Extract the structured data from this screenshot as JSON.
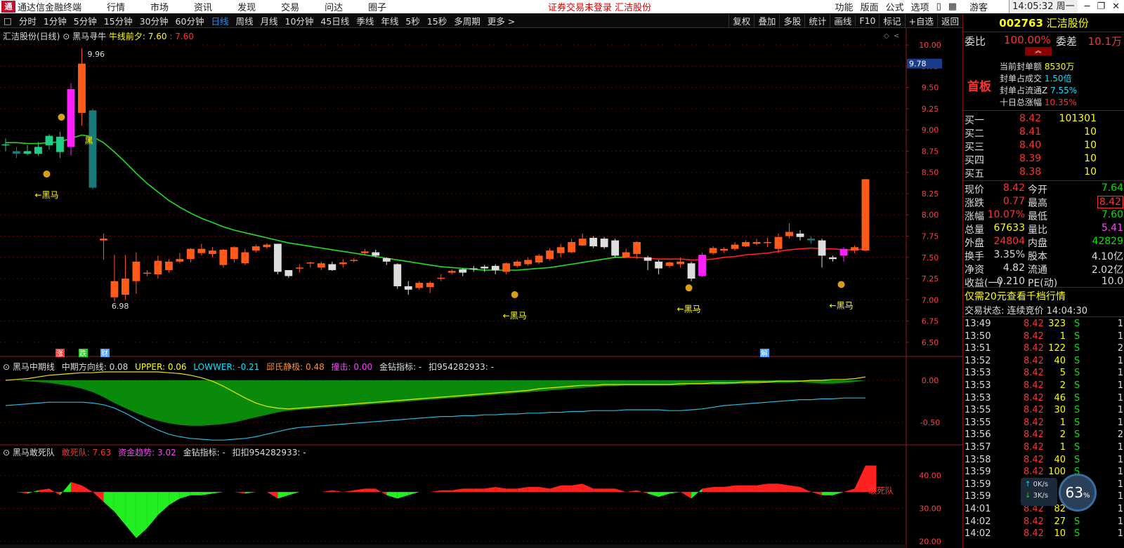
{
  "menubar": {
    "app": "通达信金融终端",
    "items": [
      "行情",
      "市场",
      "资讯",
      "发现",
      "交易",
      "问达",
      "圈子"
    ],
    "warning": "证券交易未登录  汇洁股份",
    "right": [
      "功能",
      "版面",
      "公式",
      "选项"
    ],
    "user": "游客",
    "clock": "14:05:32 周一"
  },
  "periods": {
    "items": [
      "分时",
      "1分钟",
      "5分钟",
      "15分钟",
      "30分钟",
      "60分钟",
      "日线",
      "周线",
      "月线",
      "10分钟",
      "45日线",
      "季线",
      "年线",
      "5秒",
      "15秒",
      "多周期",
      "更多 >"
    ],
    "active": "日线",
    "tools": [
      "复权",
      "叠加",
      "多股",
      "统计",
      "画线",
      "F10",
      "标记",
      "+自选",
      "返回"
    ]
  },
  "main_chart": {
    "title": "汇洁股份(日线)",
    "indicator": "黑马寻牛",
    "ind_label": "牛线前夕:",
    "ind_v1": "7.60",
    "ind_v2": "7.60",
    "price_axis": [
      "10.00",
      "9.75",
      "9.50",
      "9.25",
      "9.00",
      "8.75",
      "8.50",
      "8.25",
      "8.00",
      "7.75",
      "7.50",
      "7.25",
      "7.00",
      "6.75",
      "6.50"
    ],
    "price_tag": "9.78",
    "high_label": "9.96",
    "low_label": "6.98",
    "hm_labels": [
      "←黑马",
      "←黑马",
      "←黑马",
      "←黑马"
    ],
    "short_hm": "黑",
    "markers": [
      "涨",
      "跌",
      "财",
      "解"
    ]
  },
  "chart_data": {
    "type": "candlestick",
    "ylim": [
      6.4,
      10.05
    ],
    "ohlc": [
      [
        8.83,
        8.83,
        8.75,
        8.9
      ],
      [
        8.75,
        8.72,
        8.67,
        8.8
      ],
      [
        8.72,
        8.75,
        8.7,
        8.82
      ],
      [
        8.72,
        8.8,
        8.7,
        8.86
      ],
      [
        8.82,
        8.93,
        8.77,
        8.95
      ],
      [
        8.74,
        8.92,
        8.67,
        8.98
      ],
      [
        8.8,
        9.48,
        8.7,
        9.55
      ],
      [
        9.2,
        9.78,
        9.05,
        9.96
      ],
      [
        9.23,
        8.32,
        8.3,
        9.25
      ],
      [
        7.7,
        7.72,
        7.47,
        7.78
      ],
      [
        7.03,
        7.22,
        6.98,
        7.53
      ],
      [
        7.06,
        7.25,
        7.0,
        7.53
      ],
      [
        7.22,
        7.45,
        7.07,
        7.56
      ],
      [
        7.31,
        7.32,
        7.28,
        7.35
      ],
      [
        7.3,
        7.46,
        7.25,
        7.52
      ],
      [
        7.35,
        7.45,
        7.32,
        7.48
      ],
      [
        7.45,
        7.48,
        7.43,
        7.55
      ],
      [
        7.48,
        7.6,
        7.44,
        7.61
      ],
      [
        7.55,
        7.6,
        7.52,
        7.66
      ],
      [
        7.54,
        7.58,
        7.5,
        7.62
      ],
      [
        7.41,
        7.59,
        7.38,
        7.6
      ],
      [
        7.48,
        7.62,
        7.44,
        7.63
      ],
      [
        7.43,
        7.56,
        7.41,
        7.6
      ],
      [
        7.58,
        7.63,
        7.56,
        7.65
      ],
      [
        7.62,
        7.65,
        7.6,
        7.67
      ],
      [
        7.66,
        7.33,
        7.3,
        7.66
      ],
      [
        7.35,
        7.28,
        7.26,
        7.35
      ],
      [
        7.38,
        7.38,
        7.32,
        7.42
      ],
      [
        7.43,
        7.44,
        7.38,
        7.45
      ],
      [
        7.38,
        7.43,
        7.35,
        7.45
      ],
      [
        7.42,
        7.35,
        7.34,
        7.45
      ],
      [
        7.42,
        7.44,
        7.38,
        7.48
      ],
      [
        7.46,
        7.47,
        7.44,
        7.49
      ],
      [
        7.55,
        7.57,
        7.52,
        7.6
      ],
      [
        7.56,
        7.52,
        7.5,
        7.59
      ],
      [
        7.49,
        7.45,
        7.41,
        7.5
      ],
      [
        7.42,
        7.16,
        7.13,
        7.43
      ],
      [
        7.16,
        7.12,
        7.06,
        7.22
      ],
      [
        7.14,
        7.2,
        7.12,
        7.22
      ],
      [
        7.15,
        7.2,
        7.08,
        7.22
      ],
      [
        7.25,
        7.26,
        7.22,
        7.3
      ],
      [
        7.32,
        7.34,
        7.3,
        7.36
      ],
      [
        7.36,
        7.32,
        7.28,
        7.37
      ],
      [
        7.37,
        7.36,
        7.33,
        7.4
      ],
      [
        7.39,
        7.37,
        7.33,
        7.41
      ],
      [
        7.4,
        7.35,
        7.3,
        7.42
      ],
      [
        7.33,
        7.43,
        7.3,
        7.44
      ],
      [
        7.4,
        7.45,
        7.38,
        7.47
      ],
      [
        7.42,
        7.47,
        7.4,
        7.5
      ],
      [
        7.44,
        7.52,
        7.42,
        7.54
      ],
      [
        7.48,
        7.58,
        7.46,
        7.61
      ],
      [
        7.55,
        7.62,
        7.5,
        7.66
      ],
      [
        7.56,
        7.68,
        7.55,
        7.72
      ],
      [
        7.64,
        7.72,
        7.63,
        7.78
      ],
      [
        7.73,
        7.63,
        7.61,
        7.75
      ],
      [
        7.72,
        7.62,
        7.6,
        7.74
      ],
      [
        7.7,
        7.52,
        7.5,
        7.72
      ],
      [
        7.5,
        7.56,
        7.5,
        7.6
      ],
      [
        7.54,
        7.68,
        7.48,
        7.69
      ],
      [
        7.5,
        7.46,
        7.35,
        7.52
      ],
      [
        7.45,
        7.37,
        7.3,
        7.47
      ],
      [
        7.4,
        7.44,
        7.38,
        7.45
      ],
      [
        7.42,
        7.45,
        7.38,
        7.5
      ],
      [
        7.43,
        7.25,
        7.22,
        7.45
      ],
      [
        7.28,
        7.53,
        7.27,
        7.56
      ],
      [
        7.55,
        7.61,
        7.53,
        7.63
      ],
      [
        7.58,
        7.6,
        7.55,
        7.62
      ],
      [
        7.6,
        7.65,
        7.58,
        7.68
      ],
      [
        7.63,
        7.68,
        7.62,
        7.7
      ],
      [
        7.66,
        7.68,
        7.64,
        7.72
      ],
      [
        7.67,
        7.68,
        7.62,
        7.73
      ],
      [
        7.6,
        7.74,
        7.55,
        7.78
      ],
      [
        7.75,
        7.8,
        7.72,
        7.9
      ],
      [
        7.78,
        7.74,
        7.7,
        7.82
      ],
      [
        7.72,
        7.7,
        7.66,
        7.75
      ],
      [
        7.7,
        7.52,
        7.38,
        7.72
      ],
      [
        7.5,
        7.48,
        7.45,
        7.52
      ],
      [
        7.52,
        7.6,
        7.45,
        7.62
      ],
      [
        7.58,
        7.62,
        7.55,
        7.64
      ],
      [
        7.58,
        8.42,
        7.57,
        8.42
      ]
    ],
    "ma": [
      8.85,
      8.85,
      8.84,
      8.84,
      8.85,
      8.86,
      8.9,
      8.94,
      8.92,
      8.85,
      8.74,
      8.62,
      8.49,
      8.37,
      8.27,
      8.17,
      8.09,
      8.02,
      7.96,
      7.91,
      7.86,
      7.82,
      7.79,
      7.76,
      7.73,
      7.7,
      7.67,
      7.65,
      7.63,
      7.61,
      7.59,
      7.57,
      7.55,
      7.53,
      7.51,
      7.49,
      7.47,
      7.45,
      7.43,
      7.41,
      7.39,
      7.38,
      7.37,
      7.36,
      7.35,
      7.35,
      7.35,
      7.35,
      7.36,
      7.37,
      7.38,
      7.4,
      7.42,
      7.44,
      7.46,
      7.48,
      7.5,
      7.5,
      7.5,
      7.49,
      7.48,
      7.48,
      7.48,
      7.47,
      7.47,
      7.48,
      7.5,
      7.51,
      7.53,
      7.54,
      7.55,
      7.57,
      7.59,
      7.6,
      7.61,
      7.6,
      7.6,
      7.59,
      7.59,
      7.6
    ],
    "macd_title": "黑马中期线",
    "macd_items": [
      [
        "中期方向线:",
        "0.08"
      ],
      [
        "UPPER:",
        "0.06"
      ],
      [
        "LOWWER:",
        "-0.21"
      ],
      [
        "邱氏静极:",
        "0.48"
      ],
      [
        "撞击:",
        "0.00"
      ],
      [
        "金钻指标:",
        "-"
      ],
      [
        "扣954282933:",
        "-"
      ]
    ],
    "macd_axis": [
      "0.00",
      "-0.50"
    ],
    "macd_ylim": [
      -0.75,
      0.2
    ],
    "macd_yellow": [
      0.0,
      0.01,
      0.02,
      0.04,
      0.06,
      0.07,
      0.08,
      0.09,
      0.09,
      0.1,
      0.1,
      0.1,
      0.1,
      0.1,
      0.1,
      0.09,
      0.08,
      0.06,
      0.03,
      -0.01,
      -0.07,
      -0.14,
      -0.21,
      -0.27,
      -0.31,
      -0.33,
      -0.34,
      -0.33,
      -0.32,
      -0.31,
      -0.3,
      -0.29,
      -0.28,
      -0.27,
      -0.26,
      -0.25,
      -0.24,
      -0.23,
      -0.22,
      -0.21,
      -0.2,
      -0.19,
      -0.18,
      -0.17,
      -0.16,
      -0.15,
      -0.14,
      -0.13,
      -0.12,
      -0.1,
      -0.09,
      -0.08,
      -0.07,
      -0.06,
      -0.06,
      -0.05,
      -0.05,
      -0.05,
      -0.05,
      -0.05,
      -0.05,
      -0.05,
      -0.04,
      -0.04,
      -0.04,
      -0.03,
      -0.03,
      -0.03,
      -0.02,
      -0.02,
      -0.02,
      -0.01,
      -0.01,
      -0.01,
      0.0,
      0.0,
      0.01,
      0.01,
      0.02,
      0.04
    ],
    "macd_cyan": [
      -0.3,
      -0.29,
      -0.28,
      -0.27,
      -0.26,
      -0.26,
      -0.26,
      -0.26,
      -0.27,
      -0.29,
      -0.33,
      -0.39,
      -0.46,
      -0.53,
      -0.59,
      -0.64,
      -0.67,
      -0.69,
      -0.7,
      -0.71,
      -0.71,
      -0.7,
      -0.69,
      -0.67,
      -0.64,
      -0.61,
      -0.58,
      -0.56,
      -0.55,
      -0.54,
      -0.53,
      -0.52,
      -0.51,
      -0.5,
      -0.49,
      -0.48,
      -0.47,
      -0.46,
      -0.45,
      -0.44,
      -0.43,
      -0.43,
      -0.42,
      -0.42,
      -0.41,
      -0.41,
      -0.4,
      -0.4,
      -0.39,
      -0.39,
      -0.38,
      -0.38,
      -0.37,
      -0.37,
      -0.36,
      -0.36,
      -0.36,
      -0.35,
      -0.35,
      -0.35,
      -0.35,
      -0.36,
      -0.36,
      -0.35,
      -0.34,
      -0.32,
      -0.3,
      -0.29,
      -0.28,
      -0.27,
      -0.26,
      -0.25,
      -0.24,
      -0.23,
      -0.23,
      -0.22,
      -0.22,
      -0.21,
      -0.21,
      -0.21
    ],
    "macd_green": [
      0.0,
      0.0,
      -0.01,
      -0.02,
      -0.03,
      -0.05,
      -0.07,
      -0.1,
      -0.14,
      -0.2,
      -0.27,
      -0.33,
      -0.39,
      -0.44,
      -0.48,
      -0.51,
      -0.53,
      -0.54,
      -0.54,
      -0.53,
      -0.52,
      -0.5,
      -0.47,
      -0.44,
      -0.41,
      -0.38,
      -0.36,
      -0.35,
      -0.34,
      -0.33,
      -0.32,
      -0.31,
      -0.3,
      -0.29,
      -0.28,
      -0.27,
      -0.26,
      -0.25,
      -0.24,
      -0.23,
      -0.22,
      -0.21,
      -0.2,
      -0.19,
      -0.18,
      -0.17,
      -0.16,
      -0.15,
      -0.14,
      -0.13,
      -0.12,
      -0.11,
      -0.1,
      -0.09,
      -0.08,
      -0.07,
      -0.07,
      -0.06,
      -0.06,
      -0.06,
      -0.06,
      -0.06,
      -0.06,
      -0.05,
      -0.05,
      -0.05,
      -0.05,
      -0.04,
      -0.04,
      -0.04,
      -0.03,
      -0.03,
      -0.03,
      -0.02,
      -0.03,
      -0.04,
      -0.04,
      -0.03,
      -0.02,
      0.0
    ],
    "hs_title": "黑马敢死队",
    "hs_items": [
      [
        "敢死队:",
        "7.63"
      ],
      [
        "资金趋势:",
        "3.02"
      ],
      [
        "金钻指标:",
        "-"
      ],
      [
        "扣扣954282933:",
        "-"
      ]
    ],
    "hs_axis": [
      "40.00",
      "30.00",
      "20.00"
    ],
    "hs_ylim": [
      18,
      48
    ],
    "hs_base": 35,
    "hs_values": [
      35,
      35,
      34.5,
      35.5,
      36,
      34,
      38,
      37,
      35,
      32,
      29,
      25,
      21,
      24,
      28,
      31,
      33,
      34,
      34,
      34.5,
      35,
      35,
      34.5,
      35,
      35,
      33,
      34,
      35,
      35,
      35,
      35.5,
      35,
      35.5,
      36,
      36,
      34,
      33,
      34,
      35,
      35,
      35.5,
      35.5,
      36,
      36,
      36,
      36.5,
      36,
      36,
      36.5,
      36.5,
      36,
      37,
      37,
      37.5,
      36,
      36,
      36,
      35,
      35.5,
      34.5,
      33.5,
      34.5,
      35,
      33,
      36,
      36.5,
      36.5,
      37,
      37,
      37,
      37.5,
      37.5,
      37,
      36.5,
      35,
      34,
      34,
      35,
      36,
      43
    ],
    "hs_label": "敢死队"
  },
  "right": {
    "code": "002763",
    "name": "汇洁股份",
    "wb_label": "委比",
    "wb_pct": "100.00%",
    "wc_label": "委差",
    "wc_val": "10.1万",
    "first_board": "首板",
    "seal": [
      [
        "当前封单额",
        "8530万"
      ],
      [
        "封单占成交",
        "1.50倍"
      ],
      [
        "封单占流通Z",
        "7.55%"
      ],
      [
        "十日总涨幅",
        "10.35%"
      ]
    ],
    "bids": [
      [
        "买一",
        "8.42",
        "101301"
      ],
      [
        "买二",
        "8.41",
        "10"
      ],
      [
        "买三",
        "8.40",
        "10"
      ],
      [
        "买四",
        "8.39",
        "10"
      ],
      [
        "买五",
        "8.38",
        "10"
      ]
    ],
    "quote": [
      [
        "现价",
        "8.42",
        "今开",
        "7.64"
      ],
      [
        "涨跌",
        "0.77",
        "最高",
        "8.42"
      ],
      [
        "涨幅",
        "10.07%",
        "最低",
        "7.60"
      ],
      [
        "总量",
        "67633",
        "量比",
        "5.41"
      ],
      [
        "外盘",
        "24804",
        "内盘",
        "42829"
      ],
      [
        "换手",
        "3.35%",
        "股本",
        "4.10亿"
      ],
      [
        "净资",
        "4.82",
        "流通",
        "2.02亿"
      ],
      [
        "收益(一)",
        "0.210",
        "PE(动)",
        "10.0"
      ]
    ],
    "promo": "仅需20元查看千档行情",
    "status_label": "交易状态:",
    "status_val": "连续竞价 14:04:30",
    "ticks": [
      [
        "13:49",
        "8.42",
        "323",
        "S"
      ],
      [
        "13:50",
        "8.42",
        "1",
        "S"
      ],
      [
        "13:51",
        "8.42",
        "122",
        "S"
      ],
      [
        "13:52",
        "8.42",
        "40",
        "S"
      ],
      [
        "13:53",
        "8.42",
        "5",
        "S"
      ],
      [
        "13:53",
        "8.42",
        "2",
        "S"
      ],
      [
        "13:53",
        "8.42",
        "46",
        "S"
      ],
      [
        "13:55",
        "8.42",
        "30",
        "S"
      ],
      [
        "13:55",
        "8.42",
        "1",
        "S"
      ],
      [
        "13:56",
        "8.42",
        "2",
        "S"
      ],
      [
        "13:57",
        "8.42",
        "1",
        "S"
      ],
      [
        "13:58",
        "8.42",
        "40",
        "S"
      ],
      [
        "13:59",
        "8.42",
        "100",
        "S"
      ],
      [
        "13:59",
        "8.42",
        "",
        "S"
      ],
      [
        "13:59",
        "8.42",
        "",
        "S"
      ],
      [
        "14:01",
        "8.42",
        "82",
        "S"
      ],
      [
        "14:02",
        "8.42",
        "27",
        "S"
      ],
      [
        "14:02",
        "8.42",
        "10",
        "S"
      ]
    ],
    "tick_extra": [
      "1",
      "1",
      "2",
      "1",
      "1",
      "1",
      "1",
      "1",
      "1",
      "2",
      "1",
      "1",
      "1",
      "1",
      "1",
      "1",
      "1",
      "1"
    ],
    "speed_up": "0K/s",
    "speed_down": "3K/s",
    "gauge": "63"
  }
}
